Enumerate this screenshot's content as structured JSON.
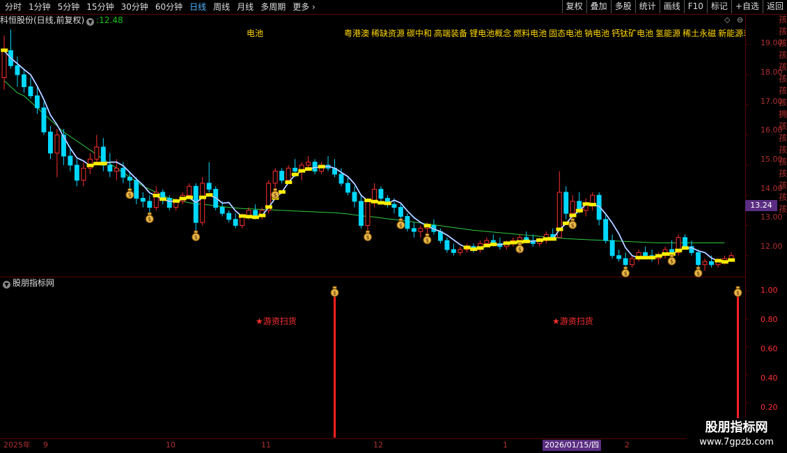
{
  "toolbar": {
    "periods": [
      "分时",
      "1分钟",
      "5分钟",
      "15分钟",
      "30分钟",
      "60分钟",
      "日线",
      "周线",
      "月线",
      "多周期",
      "更多"
    ],
    "active_period": "日线",
    "more_arrow": "›",
    "right_buttons": [
      "复权",
      "叠加",
      "多股",
      "统计",
      "画线",
      "F10",
      "标记",
      "+自选",
      "返回"
    ]
  },
  "info": {
    "stock_label": "科恒股份(日线,前复权)",
    "price_prefix": ":",
    "price": "12.48",
    "sector": "电池",
    "concepts": [
      "粤港澳",
      "稀缺资源",
      "碳中和",
      "高端装备",
      "锂电池概念",
      "燃料电池",
      "固态电池",
      "钠电池",
      "钙钛矿电池",
      "氢能源",
      "稀土永磁",
      "新能源车"
    ]
  },
  "main_axis": {
    "labels": [
      "19.00",
      "18.00",
      "17.00",
      "16.00",
      "15.00",
      "14.00",
      "13.00",
      "12.00"
    ],
    "current_price_tag": "13.24"
  },
  "indicator": {
    "title": "股朋指标网",
    "axis_labels": [
      "1.00",
      "0.80",
      "0.60",
      "0.40",
      "0.20"
    ],
    "signal_text": "★游资扫货",
    "signals": [
      {
        "label": "★游资扫货"
      },
      {
        "label": "★游资扫货"
      }
    ]
  },
  "x_axis": {
    "labels": [
      "2025年",
      "9",
      "10",
      "11",
      "12",
      "1",
      "2"
    ],
    "cursor_date": "2026/01/15/四"
  },
  "watermark": {
    "line1": "股朋指标网",
    "line2": "www.7gpzb.com"
  },
  "right_edge_text": "孩孩孩孩孩孩孩孩拥孩孩孩孩孩孩孩孩",
  "colors": {
    "up": "#ff3030",
    "down": "#00d8ff",
    "ma_green": "#2ecc40",
    "ma_blue": "#3d7dff",
    "yellow": "#ffee00",
    "magenta": "#ff30c0",
    "grid": "#5a0000"
  },
  "chart_data": {
    "type": "candlestick",
    "y_range": [
      11.3,
      19.6
    ],
    "candles": [
      [
        17.9,
        19.3,
        17.5,
        18.8
      ],
      [
        18.8,
        19.5,
        18.2,
        18.3
      ],
      [
        18.3,
        18.6,
        17.6,
        18.0
      ],
      [
        18.0,
        18.2,
        17.4,
        17.6
      ],
      [
        17.6,
        17.9,
        17.2,
        17.3
      ],
      [
        17.3,
        17.6,
        16.7,
        16.9
      ],
      [
        16.9,
        17.1,
        16.0,
        16.1
      ],
      [
        16.1,
        16.3,
        15.2,
        15.4
      ],
      [
        15.4,
        16.2,
        14.6,
        16.0
      ],
      [
        16.0,
        16.2,
        15.0,
        15.3
      ],
      [
        15.3,
        15.6,
        14.8,
        15.0
      ],
      [
        15.0,
        15.2,
        14.3,
        14.5
      ],
      [
        14.5,
        15.1,
        14.3,
        14.9
      ],
      [
        14.9,
        15.4,
        14.7,
        15.2
      ],
      [
        15.2,
        16.0,
        15.0,
        15.6
      ],
      [
        15.6,
        15.9,
        14.8,
        15.0
      ],
      [
        15.0,
        15.4,
        14.6,
        14.8
      ],
      [
        14.8,
        15.2,
        14.5,
        14.9
      ],
      [
        14.9,
        15.1,
        14.4,
        14.6
      ],
      [
        14.6,
        14.8,
        14.2,
        14.5
      ],
      [
        14.5,
        14.6,
        13.7,
        13.9
      ],
      [
        13.9,
        14.1,
        13.6,
        13.8
      ],
      [
        13.8,
        14.0,
        13.4,
        13.6
      ],
      [
        13.6,
        14.3,
        13.5,
        14.1
      ],
      [
        14.1,
        14.2,
        13.7,
        13.9
      ],
      [
        13.9,
        14.0,
        13.5,
        13.6
      ],
      [
        13.6,
        13.9,
        13.5,
        13.8
      ],
      [
        13.8,
        14.1,
        13.7,
        14.0
      ],
      [
        14.0,
        14.4,
        13.9,
        14.3
      ],
      [
        14.3,
        14.4,
        12.8,
        13.1
      ],
      [
        13.1,
        14.6,
        13.0,
        14.4
      ],
      [
        14.4,
        15.1,
        14.1,
        14.2
      ],
      [
        14.2,
        14.3,
        13.5,
        13.6
      ],
      [
        13.6,
        13.8,
        13.3,
        13.4
      ],
      [
        13.4,
        13.5,
        13.1,
        13.2
      ],
      [
        13.2,
        13.4,
        12.9,
        13.0
      ],
      [
        13.0,
        13.4,
        12.9,
        13.3
      ],
      [
        13.3,
        13.6,
        13.2,
        13.5
      ],
      [
        13.5,
        13.7,
        13.2,
        13.3
      ],
      [
        13.3,
        13.6,
        13.2,
        13.5
      ],
      [
        13.5,
        14.5,
        13.4,
        14.4
      ],
      [
        14.4,
        14.9,
        14.2,
        14.8
      ],
      [
        14.8,
        14.9,
        14.4,
        14.5
      ],
      [
        14.5,
        15.0,
        14.4,
        14.9
      ],
      [
        14.9,
        15.2,
        14.6,
        14.8
      ],
      [
        14.8,
        15.1,
        14.5,
        15.0
      ],
      [
        15.0,
        15.3,
        14.8,
        15.1
      ],
      [
        15.1,
        15.2,
        14.7,
        14.8
      ],
      [
        14.8,
        15.1,
        14.7,
        15.0
      ],
      [
        15.0,
        15.3,
        14.8,
        14.9
      ],
      [
        14.9,
        15.2,
        14.6,
        14.7
      ],
      [
        14.7,
        14.9,
        14.3,
        14.4
      ],
      [
        14.4,
        14.6,
        14.0,
        14.1
      ],
      [
        14.1,
        14.3,
        13.6,
        13.8
      ],
      [
        13.8,
        14.0,
        12.9,
        13.0
      ],
      [
        13.0,
        13.9,
        12.8,
        13.8
      ],
      [
        13.8,
        14.4,
        13.6,
        14.2
      ],
      [
        14.2,
        14.3,
        13.8,
        13.9
      ],
      [
        13.9,
        14.0,
        13.6,
        13.7
      ],
      [
        13.7,
        13.9,
        13.4,
        13.6
      ],
      [
        13.6,
        13.7,
        13.2,
        13.3
      ],
      [
        13.3,
        13.4,
        12.8,
        12.9
      ],
      [
        12.9,
        13.1,
        12.6,
        12.8
      ],
      [
        12.8,
        13.0,
        12.6,
        12.9
      ],
      [
        12.9,
        13.1,
        12.7,
        13.0
      ],
      [
        13.0,
        13.2,
        12.7,
        12.8
      ],
      [
        12.8,
        12.9,
        12.4,
        12.5
      ],
      [
        12.5,
        12.6,
        12.1,
        12.2
      ],
      [
        12.2,
        12.4,
        12.0,
        12.1
      ],
      [
        12.1,
        12.3,
        12.0,
        12.2
      ],
      [
        12.2,
        12.4,
        12.1,
        12.3
      ],
      [
        12.3,
        12.4,
        12.1,
        12.2
      ],
      [
        12.2,
        12.5,
        12.1,
        12.4
      ],
      [
        12.4,
        12.6,
        12.3,
        12.5
      ],
      [
        12.5,
        12.7,
        12.3,
        12.4
      ],
      [
        12.4,
        12.6,
        12.2,
        12.3
      ],
      [
        12.3,
        12.5,
        12.2,
        12.4
      ],
      [
        12.4,
        12.6,
        12.3,
        12.5
      ],
      [
        12.5,
        12.7,
        12.4,
        12.6
      ],
      [
        12.6,
        12.8,
        12.4,
        12.5
      ],
      [
        12.5,
        12.7,
        12.3,
        12.4
      ],
      [
        12.4,
        12.6,
        12.3,
        12.5
      ],
      [
        12.5,
        12.8,
        12.4,
        12.7
      ],
      [
        12.7,
        12.9,
        12.5,
        12.6
      ],
      [
        12.6,
        14.8,
        12.6,
        14.1
      ],
      [
        14.1,
        14.3,
        13.2,
        13.4
      ],
      [
        13.4,
        14.0,
        13.2,
        13.8
      ],
      [
        13.8,
        14.1,
        13.4,
        13.5
      ],
      [
        13.5,
        13.9,
        13.3,
        13.7
      ],
      [
        13.7,
        14.1,
        13.5,
        14.0
      ],
      [
        14.0,
        14.1,
        13.0,
        13.2
      ],
      [
        13.2,
        13.4,
        12.4,
        12.5
      ],
      [
        12.5,
        12.7,
        11.9,
        12.0
      ],
      [
        12.0,
        12.2,
        11.8,
        11.9
      ],
      [
        11.9,
        12.1,
        11.6,
        11.7
      ],
      [
        11.7,
        12.0,
        11.6,
        11.9
      ],
      [
        11.9,
        12.2,
        11.8,
        12.1
      ],
      [
        12.1,
        12.3,
        11.9,
        12.0
      ],
      [
        12.0,
        12.2,
        11.8,
        11.9
      ],
      [
        11.9,
        12.1,
        11.7,
        12.0
      ],
      [
        12.0,
        12.3,
        11.9,
        12.2
      ],
      [
        12.2,
        12.5,
        12.0,
        12.1
      ],
      [
        12.1,
        12.7,
        12.0,
        12.6
      ],
      [
        12.6,
        12.7,
        12.2,
        12.3
      ],
      [
        12.3,
        12.5,
        12.0,
        12.1
      ],
      [
        12.1,
        12.2,
        11.6,
        11.7
      ],
      [
        11.7,
        11.9,
        11.5,
        11.8
      ],
      [
        11.8,
        12.0,
        11.6,
        11.7
      ],
      [
        11.7,
        11.9,
        11.6,
        11.8
      ],
      [
        11.8,
        12.0,
        11.7,
        11.9
      ],
      [
        11.9,
        12.1,
        11.8,
        12.0
      ]
    ],
    "ma_slow": [
      17.8,
      17.6,
      17.4,
      17.3,
      17.1,
      16.9,
      16.7,
      16.5,
      16.3,
      16.1,
      15.95,
      15.8,
      15.65,
      15.5,
      15.35,
      15.2,
      15.05,
      14.9,
      14.75,
      14.6,
      14.45,
      14.3,
      14.2,
      14.1,
      14.0,
      13.9,
      13.85,
      13.8,
      13.75,
      13.72,
      13.7,
      13.68,
      13.65,
      13.62,
      13.6,
      13.58,
      13.56,
      13.55,
      13.54,
      13.53,
      13.52,
      13.51,
      13.5,
      13.49,
      13.48,
      13.47,
      13.46,
      13.45,
      13.44,
      13.43,
      13.42,
      13.4,
      13.38,
      13.35,
      13.32,
      13.3,
      13.28,
      13.25,
      13.22,
      13.2,
      13.17,
      13.14,
      13.11,
      13.08,
      13.05,
      13.02,
      12.99,
      12.96,
      12.93,
      12.9,
      12.87,
      12.84,
      12.82,
      12.8,
      12.78,
      12.76,
      12.74,
      12.72,
      12.7,
      12.68,
      12.66,
      12.64,
      12.62,
      12.6,
      12.58,
      12.56,
      12.55,
      12.54,
      12.53,
      12.52,
      12.51,
      12.5,
      12.49,
      12.48,
      12.47,
      12.46,
      12.45,
      12.44,
      12.43,
      12.42,
      12.42,
      12.42,
      12.42,
      12.42,
      12.42,
      12.42,
      12.42,
      12.42,
      12.42,
      12.42
    ],
    "signal_positions": [
      50,
      111
    ]
  }
}
